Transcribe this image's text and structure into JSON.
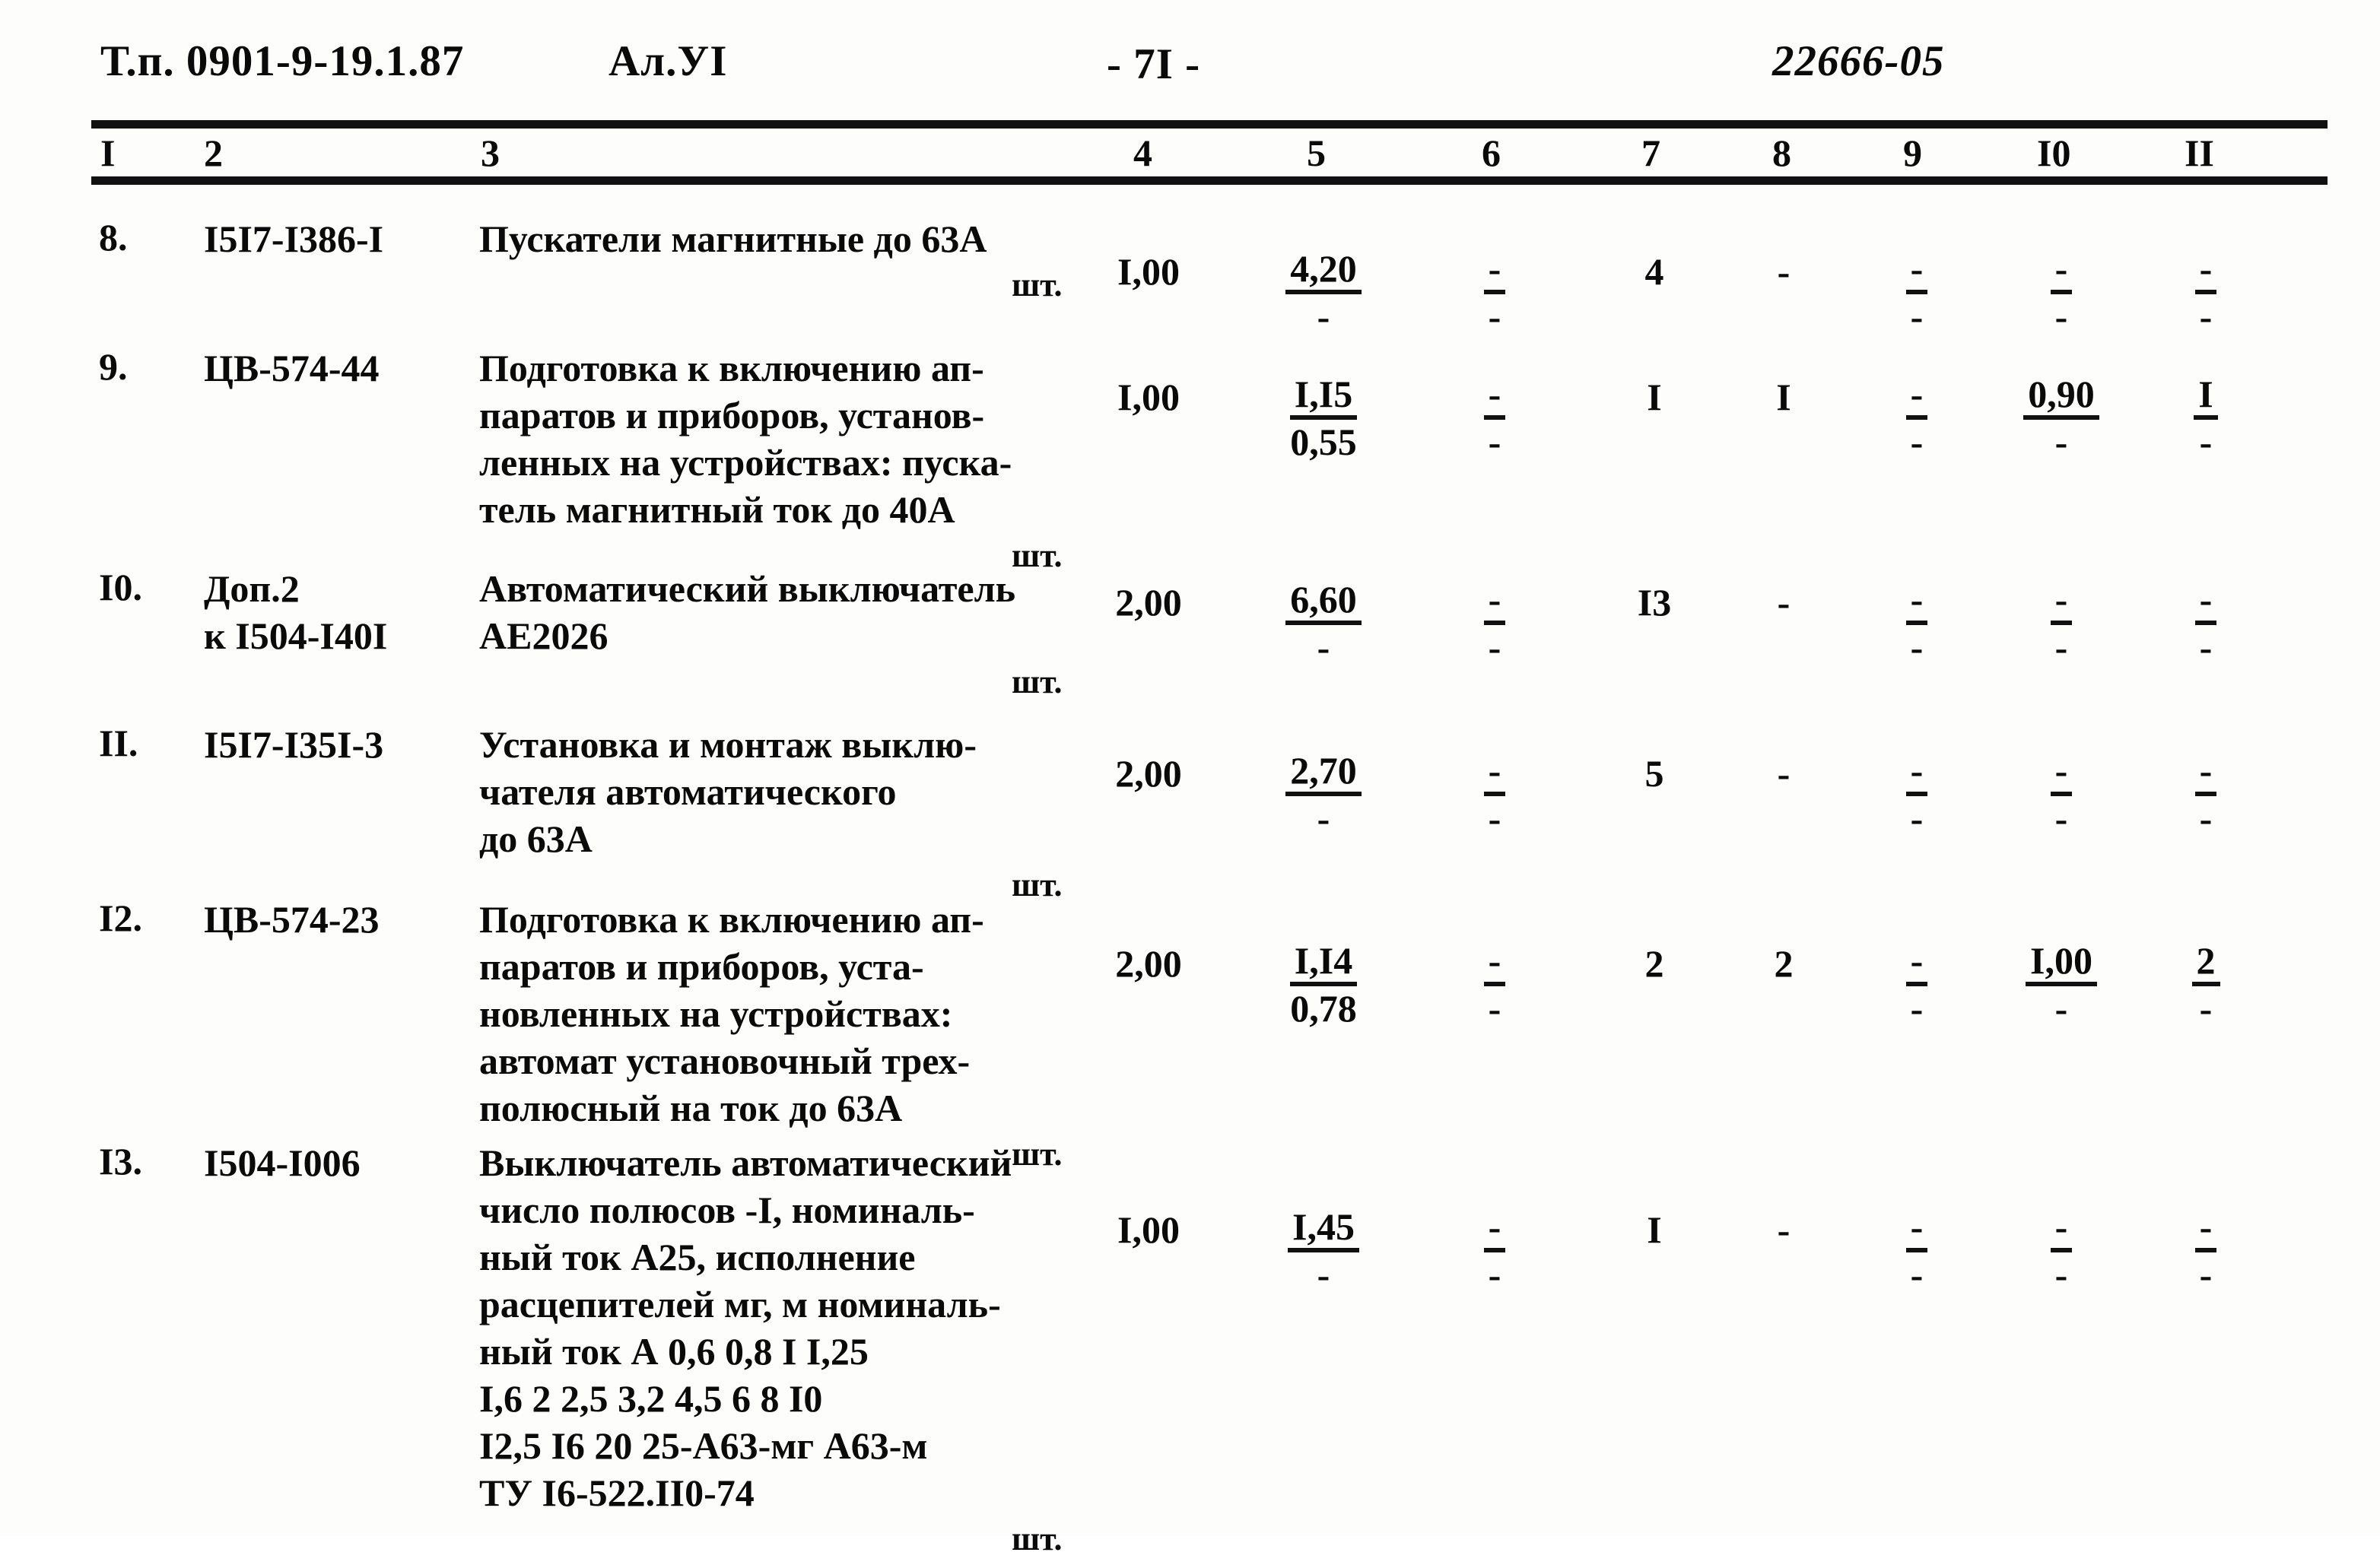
{
  "header": {
    "type_project": "Т.п. 0901-9-19.1.87",
    "album": "Ал.УI",
    "page_marker": "- 7I -",
    "doc_code": "22666-05"
  },
  "table": {
    "column_numbers": [
      "I",
      "2",
      "3",
      "4",
      "5",
      "6",
      "7",
      "8",
      "9",
      "I0",
      "II"
    ],
    "unit_label": "шт.",
    "dash": "-",
    "rows": [
      {
        "num": "8.",
        "code_lines": [
          "I5I7-I386-I"
        ],
        "desc_lines": [
          "Пускатели магнитные до 63А"
        ],
        "unit": "шт.",
        "c4": "I,00",
        "c5_top": "4,20",
        "c5_bot": "-",
        "c6_top": "-",
        "c6_bot": "-",
        "c7": "4",
        "c8": "-",
        "c9_top": "-",
        "c9_bot": "-",
        "c10_top": "-",
        "c10_bot": "-",
        "c11_top": "-",
        "c11_bot": "-"
      },
      {
        "num": "9.",
        "code_lines": [
          "ЦВ-574-44"
        ],
        "desc_lines": [
          "Подготовка к включению ап-",
          "паратов и приборов, установ-",
          "ленных на устройствах: пуска-",
          "тель магнитный ток до 40А"
        ],
        "unit": "шт.",
        "c4": "I,00",
        "c5_top": "I,I5",
        "c5_bot": "0,55",
        "c6_top": "-",
        "c6_bot": "-",
        "c7": "I",
        "c8": "I",
        "c9_top": "-",
        "c9_bot": "-",
        "c10_top": "0,90",
        "c10_bot": "-",
        "c11_top": "I",
        "c11_bot": "-"
      },
      {
        "num": "I0.",
        "code_lines": [
          "Доп.2",
          "к I504-I40I"
        ],
        "desc_lines": [
          "Автоматический выключатель",
          "АЕ2026"
        ],
        "unit": "шт.",
        "c4": "2,00",
        "c5_top": "6,60",
        "c5_bot": "-",
        "c6_top": "-",
        "c6_bot": "-",
        "c7": "I3",
        "c8": "-",
        "c9_top": "-",
        "c9_bot": "-",
        "c10_top": "-",
        "c10_bot": "-",
        "c11_top": "-",
        "c11_bot": "-"
      },
      {
        "num": "II.",
        "code_lines": [
          "I5I7-I35I-3"
        ],
        "desc_lines": [
          "Установка и монтаж выклю-",
          "чателя автоматического",
          "до 63А"
        ],
        "unit": "шт.",
        "c4": "2,00",
        "c5_top": "2,70",
        "c5_bot": "-",
        "c6_top": "-",
        "c6_bot": "-",
        "c7": "5",
        "c8": "-",
        "c9_top": "-",
        "c9_bot": "-",
        "c10_top": "-",
        "c10_bot": "-",
        "c11_top": "-",
        "c11_bot": "-"
      },
      {
        "num": "I2.",
        "code_lines": [
          "ЦВ-574-23"
        ],
        "desc_lines": [
          "Подготовка к включению ап-",
          "паратов и приборов, уста-",
          "новленных на устройствах:",
          "автомат установочный трех-",
          "полюсный на ток до 63А"
        ],
        "unit": "шт.",
        "c4": "2,00",
        "c5_top": "I,I4",
        "c5_bot": "0,78",
        "c6_top": "-",
        "c6_bot": "-",
        "c7": "2",
        "c8": "2",
        "c9_top": "-",
        "c9_bot": "-",
        "c10_top": "I,00",
        "c10_bot": "-",
        "c11_top": "2",
        "c11_bot": "-"
      },
      {
        "num": "I3.",
        "code_lines": [
          "I504-I006"
        ],
        "desc_lines": [
          "Выключатель автоматический",
          "число полюсов -I, номиналь-",
          "ный ток А25, исполнение",
          "расцепителей мг, м номиналь-",
          "ный ток А 0,6 0,8 I I,25",
          "I,6 2 2,5 3,2 4,5 6 8 I0",
          "I2,5 I6 20 25-А63-мг А63-м",
          "ТУ I6-522.II0-74"
        ],
        "unit": "шт.",
        "c4": "I,00",
        "c5_top": "I,45",
        "c5_bot": "-",
        "c6_top": "-",
        "c6_bot": "-",
        "c7": "I",
        "c8": "-",
        "c9_top": "-",
        "c9_bot": "-",
        "c10_top": "-",
        "c10_bot": "-",
        "c11_top": "-",
        "c11_bot": "-"
      }
    ]
  }
}
